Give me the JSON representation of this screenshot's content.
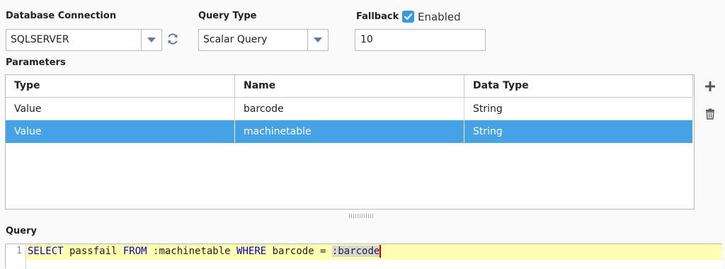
{
  "database_connection": {
    "label": "Database Connection",
    "value": "SQLSERVER",
    "refresh_icon": "refresh-icon"
  },
  "query_type": {
    "label": "Query Type",
    "value": "Scalar Query"
  },
  "fallback": {
    "label": "Fallback",
    "enabled_label": "Enabled",
    "enabled": true,
    "value": "10"
  },
  "parameters": {
    "label": "Parameters",
    "columns": [
      "Type",
      "Name",
      "Data Type"
    ],
    "rows": [
      {
        "type": "Value",
        "name": "barcode",
        "data_type": "String",
        "selected": false
      },
      {
        "type": "Value",
        "name": "machinetable",
        "data_type": "String",
        "selected": true
      }
    ],
    "add_icon": "plus-icon",
    "delete_icon": "trash-icon"
  },
  "query": {
    "label": "Query",
    "line_number": "1",
    "tokens": {
      "kw_select": "SELECT",
      "t1": " passfail ",
      "kw_from": "FROM",
      "t2": " :machinetable ",
      "kw_where": "WHERE",
      "t3": " barcode = ",
      "selected": ":barcode"
    }
  },
  "colors": {
    "accent": "#45a3e5",
    "checkbox": "#3a98e0",
    "keyword": "#0000cc",
    "editor_line": "#ffffb3",
    "caret": "#d00000"
  }
}
